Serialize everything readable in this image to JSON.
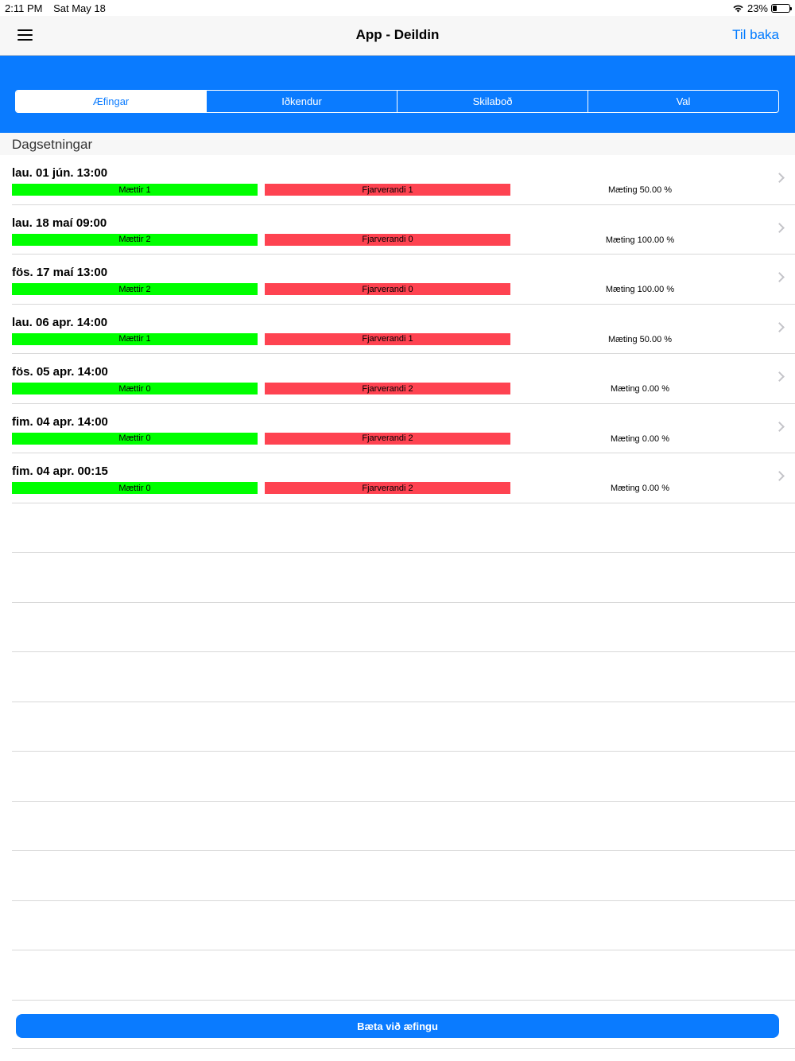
{
  "status_bar": {
    "time": "2:11 PM",
    "date": "Sat May 18",
    "battery": "23%",
    "battery_level": 0.23
  },
  "nav": {
    "title": "App - Deildin",
    "back_label": "Til baka",
    "menu_icon": "hamburger-icon"
  },
  "tabs": [
    {
      "label": "Æfingar",
      "active": true
    },
    {
      "label": "Iðkendur",
      "active": false
    },
    {
      "label": "Skilaboð",
      "active": false
    },
    {
      "label": "Val",
      "active": false
    }
  ],
  "section": {
    "title": "Dagsetningar"
  },
  "sessions": [
    {
      "date": "lau. 01 jún. 13:00",
      "present": "Mættir 1",
      "absent": "Fjarverandi 1",
      "attendance": "Mæting 50.00 %"
    },
    {
      "date": "lau. 18 maí 09:00",
      "present": "Mættir 2",
      "absent": "Fjarverandi 0",
      "attendance": "Mæting 100.00 %"
    },
    {
      "date": "fös. 17 maí 13:00",
      "present": "Mættir 2",
      "absent": "Fjarverandi 0",
      "attendance": "Mæting 100.00 %"
    },
    {
      "date": "lau. 06 apr. 14:00",
      "present": "Mættir 1",
      "absent": "Fjarverandi 1",
      "attendance": "Mæting 50.00 %"
    },
    {
      "date": "fös. 05 apr. 14:00",
      "present": "Mættir 0",
      "absent": "Fjarverandi 2",
      "attendance": "Mæting 0.00 %"
    },
    {
      "date": "fim. 04 apr. 14:00",
      "present": "Mættir 0",
      "absent": "Fjarverandi 2",
      "attendance": "Mæting 0.00 %"
    },
    {
      "date": "fim. 04 apr. 00:15",
      "present": "Mættir 0",
      "absent": "Fjarverandi 2",
      "attendance": "Mæting 0.00 %"
    }
  ],
  "footer": {
    "add_button": "Bæta við æfingu"
  },
  "colors": {
    "accent": "#0a7bff",
    "present": "#00ff00",
    "absent": "#fe4351"
  }
}
